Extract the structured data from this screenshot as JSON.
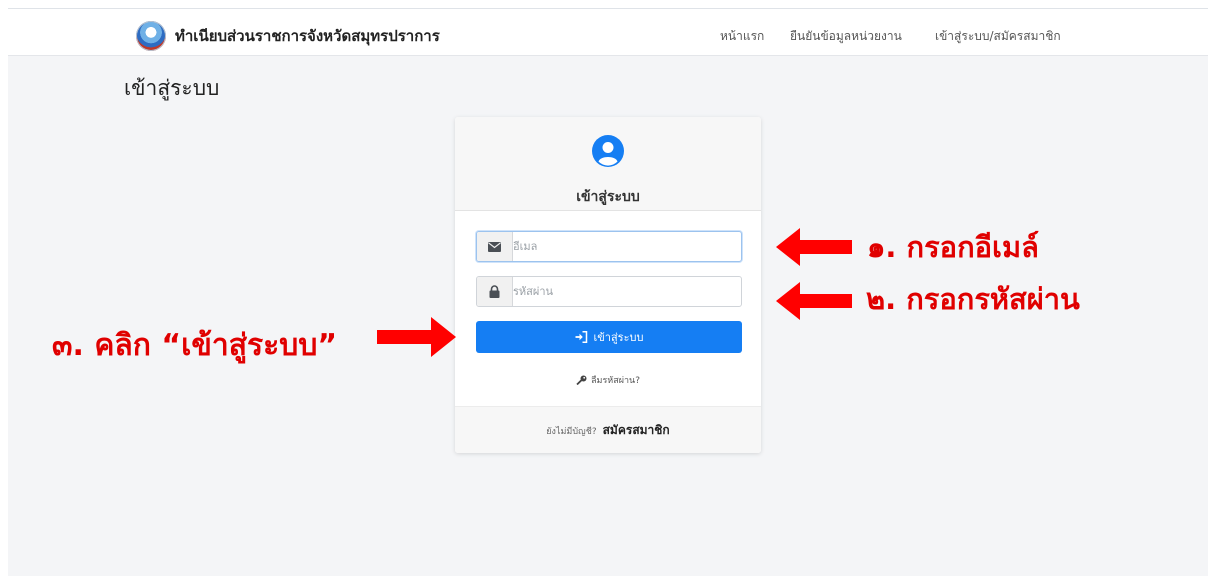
{
  "navbar": {
    "brand": "ทำเนียบส่วนราชการจังหวัดสมุทรปราการ",
    "items": [
      {
        "label": "หน้าแรก"
      },
      {
        "label": "ยืนยันข้อมูลหน่วยงาน"
      },
      {
        "label": "เข้าสู่ระบบ/สมัครสมาชิก"
      }
    ]
  },
  "page": {
    "title": "เข้าสู่ระบบ"
  },
  "card": {
    "icon": "user-circle-icon",
    "title": "เข้าสู่ระบบ",
    "email": {
      "placeholder": "อีเมล",
      "value": ""
    },
    "password": {
      "placeholder": "รหัสผ่าน",
      "value": ""
    },
    "login_label": "เข้าสู่ระบบ",
    "forgot_label": "ลืมรหัสผ่าน?",
    "footer_question": "ยังไม่มีบัญชี?",
    "register_label": "สมัครสมาชิก"
  },
  "annotations": {
    "step1": "๑. กรอกอีเมล์",
    "step2": "๒. กรอกรหัสผ่าน",
    "step3": "๓. คลิก “เข้าสู่ระบบ”",
    "color": "#e00000"
  },
  "colors": {
    "primary": "#157ef3",
    "background": "#f4f5f7"
  }
}
